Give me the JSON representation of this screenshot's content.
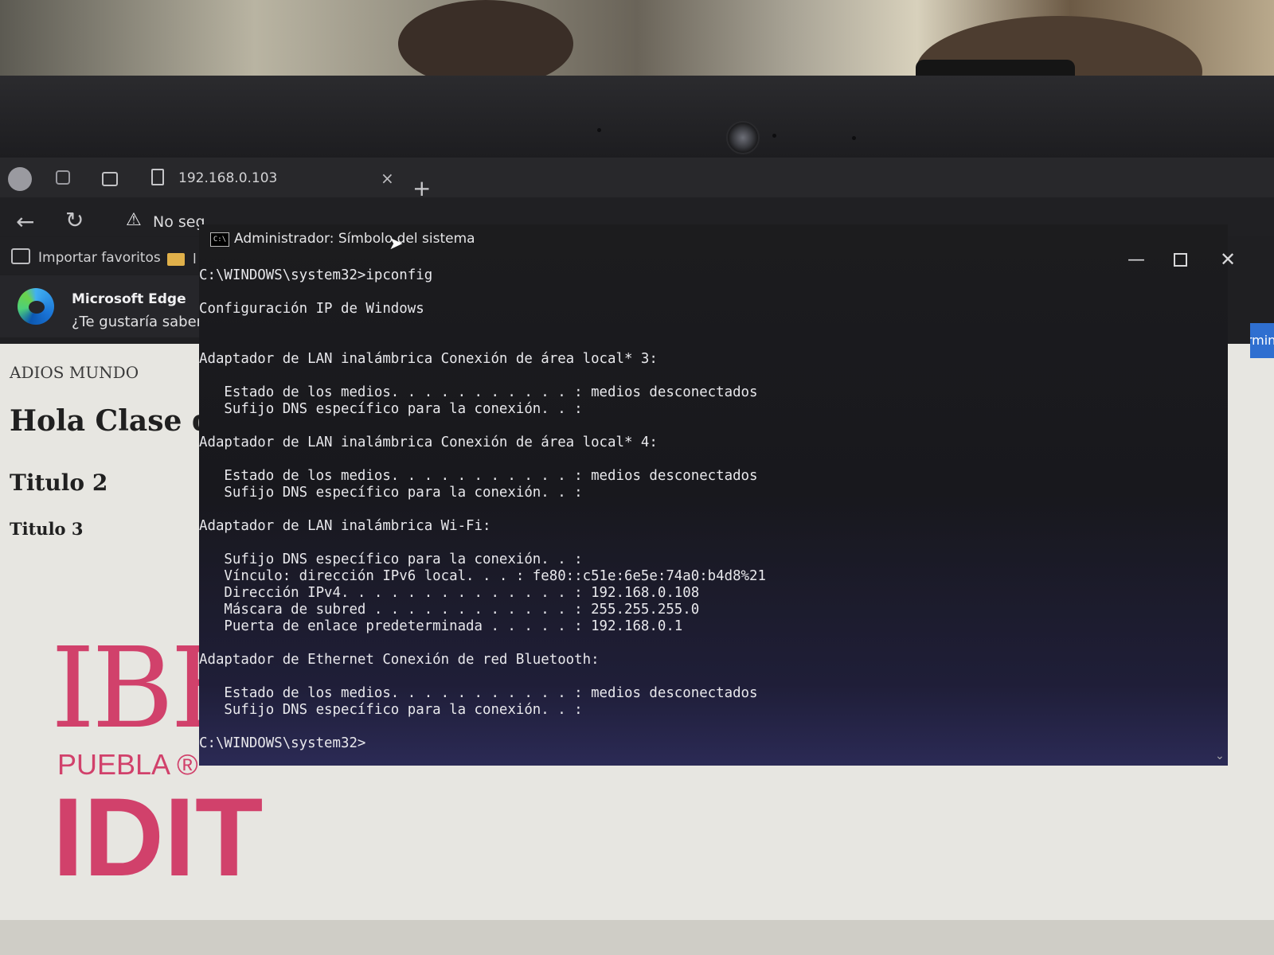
{
  "browser": {
    "tab_title": "192.168.0.103",
    "tab_close": "×",
    "new_tab": "+",
    "back": "←",
    "refresh": "↻",
    "warning_icon": "⚠",
    "security_text": "No seg",
    "favorites": {
      "import_label": "Importar favoritos",
      "folder_label": "l"
    },
    "edge_banner": {
      "title": "Microsoft Edge",
      "message": "¿Te gustaría saber"
    }
  },
  "page": {
    "line1": "ADIOS MUNDO",
    "heading1": "Hola Clase d",
    "heading2": "Titulo 2",
    "heading3": "Titulo 3",
    "logo_ibero": "IBE",
    "logo_puebla": "PUEBLA ®",
    "logo_idit": "IDIT",
    "right_tab": "ermin"
  },
  "cmd": {
    "icon_text": "C:\\",
    "title": "Administrador: Símbolo del sistema",
    "minimize": "—",
    "close": "✕",
    "output": "C:\\WINDOWS\\system32>ipconfig\n\nConfiguración IP de Windows\n\n\nAdaptador de LAN inalámbrica Conexión de área local* 3:\n\n   Estado de los medios. . . . . . . . . . . : medios desconectados\n   Sufijo DNS específico para la conexión. . :\n\nAdaptador de LAN inalámbrica Conexión de área local* 4:\n\n   Estado de los medios. . . . . . . . . . . : medios desconectados\n   Sufijo DNS específico para la conexión. . :\n\nAdaptador de LAN inalámbrica Wi-Fi:\n\n   Sufijo DNS específico para la conexión. . :\n   Vínculo: dirección IPv6 local. . . : fe80::c51e:6e5e:74a0:b4d8%21\n   Dirección IPv4. . . . . . . . . . . . . . : 192.168.0.108\n   Máscara de subred . . . . . . . . . . . . : 255.255.255.0\n   Puerta de enlace predeterminada . . . . . : 192.168.0.1\n\nAdaptador de Ethernet Conexión de red Bluetooth:\n\n   Estado de los medios. . . . . . . . . . . : medios desconectados\n   Sufijo DNS específico para la conexión. . :\n\nC:\\WINDOWS\\system32>"
  },
  "icons": [
    "profile-icon",
    "workspaces-icon",
    "tab-actions-icon",
    "page-icon",
    "close-icon",
    "plus-icon",
    "back-arrow-icon",
    "refresh-icon",
    "warning-icon",
    "import-favorites-icon",
    "folder-icon",
    "edge-logo-icon",
    "cmd-icon",
    "minimize-icon",
    "maximize-icon",
    "close-window-icon",
    "mouse-cursor-icon",
    "scroll-down-icon"
  ],
  "colors": {
    "accent_pink": "#d1416b",
    "cmd_text": "#e8e8ec",
    "edge_blue": "#2f6fd0"
  }
}
